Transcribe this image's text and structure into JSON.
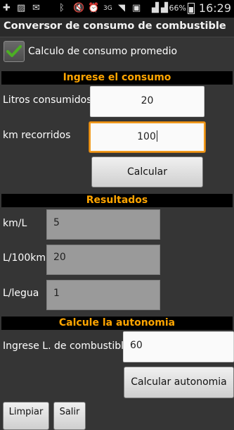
{
  "status_bar": {
    "battery_percent": "66%",
    "time": "16:29",
    "network_label": "3G",
    "icons": [
      "add-icon",
      "image-icon",
      "mail-icon",
      "bluetooth-icon",
      "mute-icon",
      "alarm-icon",
      "network-3g-icon",
      "wifi-icon",
      "nfc-icon",
      "signal-icon",
      "battery-icon"
    ]
  },
  "app": {
    "title": "Conversor de consumo de combustible"
  },
  "average_option": {
    "label": "Calculo de consumo promedio",
    "checked": true,
    "accent_color": "#4caf24"
  },
  "input_section": {
    "header": "Ingrese el consumo",
    "liters_label": "Litros consumidos",
    "liters_value": "20",
    "km_label": "km recorridos",
    "km_value": "100",
    "calculate_button": "Calcular"
  },
  "results_section": {
    "header": "Resultados",
    "rows": [
      {
        "label": "km/L",
        "value": "5"
      },
      {
        "label": "L/100km",
        "value": "20"
      },
      {
        "label": "L/legua",
        "value": "1"
      }
    ]
  },
  "autonomy_section": {
    "header": "Calcule la autonomia",
    "fuel_label": "Ingrese L. de combustible",
    "fuel_value": "60",
    "calculate_button": "Calcular autonomia"
  },
  "bottom_buttons": [
    "Limpiar",
    "Salir"
  ],
  "colors": {
    "section_header_text": "#ffa500",
    "focus_border": "#f19a1e",
    "background": "#353535"
  }
}
